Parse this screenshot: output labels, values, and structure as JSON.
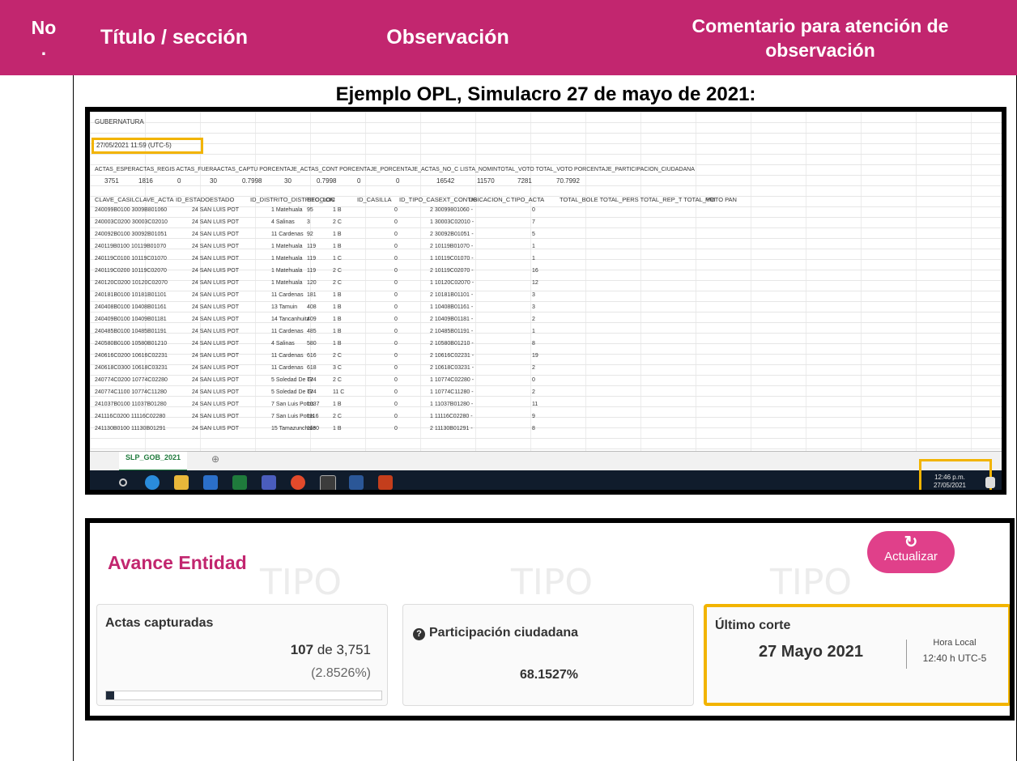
{
  "header": {
    "no_line1": "No",
    "no_line2": ".",
    "titulo": "Título / sección",
    "observacion": "Observación",
    "comentario_line1": "Comentario para atención de",
    "comentario_line2": "observación"
  },
  "example_title": "Ejemplo OPL, Simulacro 27 de mayo de 2021:",
  "spreadsheet": {
    "title_cell": "GUBERNATURA",
    "timestamp_cell": "27/05/2021 11:59 (UTC-5)",
    "summary_headers": "ACTAS_ESPERACTAS_REGIS ACTAS_FUERAACTAS_CAPTU PORCENTAJE_ACTAS_CONT PORCENTAJE_PORCENTAJE_ACTAS_NO_C LISTA_NOMINTOTAL_VOTO TOTAL_VOTO PORCENTAJE_PARTICIPACION_CIUDADANA",
    "summary_values": [
      "3751",
      "1816",
      "0",
      "30",
      "0.7998",
      "30",
      "0.7998",
      "0",
      "0",
      "16542",
      "11570",
      "7281",
      "70.7992"
    ],
    "column_headers": [
      "CLAVE_CASILCLAVE_ACTA",
      "ID_ESTADO",
      "ESTADO",
      "ID_DISTRITO_DISTRITO_LOC",
      "SECCION",
      "ID_CASILLA",
      "ID_TIPO_CASEXT_CONTIG",
      "UBICACION_C",
      "TIPO_ACTA",
      "TOTAL_BOLE TOTAL_PERS TOTAL_REP_T TOTAL_VOTO PAN",
      "PRI"
    ],
    "rows": [
      [
        "240099B0100 3009B801060",
        "24 SAN LUIS POT",
        "1 Matehuala",
        "95",
        "1 B",
        "0",
        "2 30099801060 -",
        "0"
      ],
      [
        "240003C0200 30003C02010",
        "24 SAN LUIS POT",
        "4 Salinas",
        "3",
        "2 C",
        "0",
        "1 30003C02010 -",
        "7"
      ],
      [
        "240092B0100 30092B01051",
        "24 SAN LUIS POT",
        "11 Cardenas",
        "92",
        "1 B",
        "0",
        "2 30092B01051 -",
        "5"
      ],
      [
        "240119B0100 10119B01070",
        "24 SAN LUIS POT",
        "1 Matehuala",
        "119",
        "1 B",
        "0",
        "2 10119B01070 -",
        "1"
      ],
      [
        "240119C0100 10119C01070",
        "24 SAN LUIS POT",
        "1 Matehuala",
        "119",
        "1 C",
        "0",
        "1 10119C01070 -",
        "1"
      ],
      [
        "240119C0200 10119C02070",
        "24 SAN LUIS POT",
        "1 Matehuala",
        "119",
        "2 C",
        "0",
        "2 10119C02070 -",
        "16"
      ],
      [
        "240120C0200 10120C02070",
        "24 SAN LUIS POT",
        "1 Matehuala",
        "120",
        "2 C",
        "0",
        "1 10120C02070 -",
        "12"
      ],
      [
        "240181B0100 10181B01101",
        "24 SAN LUIS POT",
        "11 Cardenas",
        "181",
        "1 B",
        "0",
        "2 10181B01101 -",
        "3"
      ],
      [
        "240408B0100 10408B01161",
        "24 SAN LUIS POT",
        "13 Tamuin",
        "408",
        "1 B",
        "0",
        "1 10408B01161 -",
        "3"
      ],
      [
        "240409B0100 10409B01181",
        "24 SAN LUIS POT",
        "14 Tancanhuitz",
        "409",
        "1 B",
        "0",
        "2 10409B01181 -",
        "2"
      ],
      [
        "240485B0100 10485B01191",
        "24 SAN LUIS POT",
        "11 Cardenas",
        "485",
        "1 B",
        "0",
        "2 10485B01191 -",
        "1"
      ],
      [
        "240580B0100 10580B01210",
        "24 SAN LUIS POT",
        "4 Salinas",
        "580",
        "1 B",
        "0",
        "2 10580B01210 -",
        "8"
      ],
      [
        "240616C0200 10616C02231",
        "24 SAN LUIS POT",
        "11 Cardenas",
        "616",
        "2 C",
        "0",
        "2 10616C02231 -",
        "19"
      ],
      [
        "240618C0300 10618C03231",
        "24 SAN LUIS POT",
        "11 Cardenas",
        "618",
        "3 C",
        "0",
        "2 10618C03231 -",
        "2"
      ],
      [
        "240774C0200 10774C02280",
        "24 SAN LUIS POT",
        "5 Soledad De Gr",
        "774",
        "2 C",
        "0",
        "1 10774C02280 -",
        "0"
      ],
      [
        "240774C1100 10774C11280",
        "24 SAN LUIS POT",
        "5 Soledad De Gr",
        "774",
        "11 C",
        "0",
        "1 10774C11280 -",
        "2"
      ],
      [
        "241037B0100 11037B01280",
        "24 SAN LUIS POT",
        "7 San Luis Potos",
        "1037",
        "1 B",
        "0",
        "1 11037B01280 -",
        "11"
      ],
      [
        "241116C0200 11116C02280",
        "24 SAN LUIS POT",
        "7 San Luis Potos",
        "1116",
        "2 C",
        "0",
        "1 11116C02280 -",
        "9"
      ],
      [
        "241130B0100 11130B01291",
        "24 SAN LUIS POT",
        "15 Tamazunchale",
        "1130",
        "1 B",
        "0",
        "2 11130B01291 -",
        "8"
      ]
    ],
    "sheet_tab": "SLP_GOB_2021",
    "clock_time": "12:46 p.m.",
    "clock_date": "27/05/2021"
  },
  "avance": {
    "title": "Avance Entidad",
    "watermark": "TIPO",
    "refresh_icon": "refresh-icon",
    "refresh_label": "Actualizar",
    "actas_label": "Actas capturadas",
    "actas_captured": "107",
    "actas_of": " de 3,751",
    "actas_pct": "(2.8526%)",
    "actas_progress_fraction": 0.028526,
    "participacion_label": "Participación ciudadana",
    "participacion_value": "68.1527%",
    "ultimo_corte_label": "Último corte",
    "corte_date": "27 Mayo 2021",
    "hora_local_label": "Hora Local",
    "hora_value": "12:40 h UTC-5"
  },
  "colors": {
    "header_bg": "#c2266f",
    "highlight": "#f2b400",
    "refresh_btn": "#e0408a"
  }
}
